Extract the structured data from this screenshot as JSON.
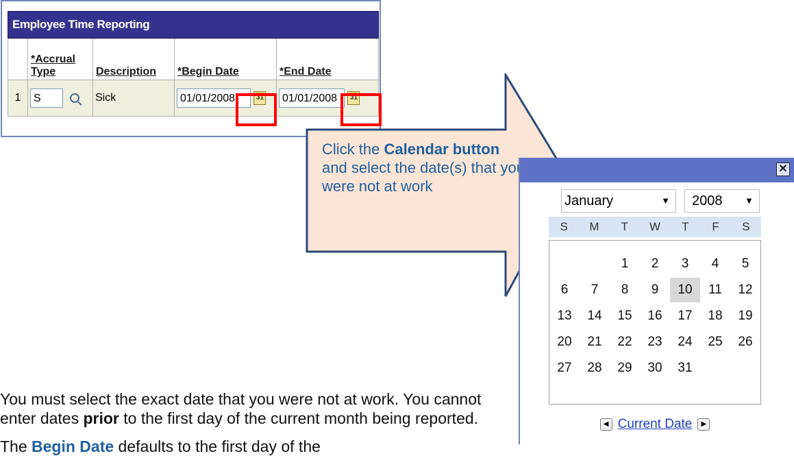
{
  "grid": {
    "title": "Employee Time Reporting",
    "columns": {
      "accrual_type": "*Accrual Type",
      "description": "Description",
      "begin_date": "*Begin Date",
      "end_date": "*End Date"
    },
    "row": {
      "num": "1",
      "accrual_type": "S",
      "description": "Sick",
      "begin_date": "01/01/2008",
      "end_date": "01/01/2008"
    },
    "calendar_icon_glyph": "31"
  },
  "callout": {
    "text_1": "Click the ",
    "bold_1": "Calendar button",
    "text_2": " and select the date(s) that you were not at work",
    "fill": "#fbe5d6",
    "stroke": "#2b4a7a"
  },
  "calendar": {
    "close_glyph": "✕",
    "month": "January",
    "year": "2008",
    "weekdays": [
      "S",
      "M",
      "T",
      "W",
      "T",
      "F",
      "S"
    ],
    "weeks": [
      [
        "",
        "",
        "1",
        "2",
        "3",
        "4",
        "5"
      ],
      [
        "6",
        "7",
        "8",
        "9",
        "10",
        "11",
        "12"
      ],
      [
        "13",
        "14",
        "15",
        "16",
        "17",
        "18",
        "19"
      ],
      [
        "20",
        "21",
        "22",
        "23",
        "24",
        "25",
        "26"
      ],
      [
        "27",
        "28",
        "29",
        "30",
        "31",
        "",
        ""
      ]
    ],
    "today": "10",
    "current_date_link": "Current Date",
    "prev_glyph": "◀",
    "next_glyph": "▶"
  },
  "body": {
    "para1_a": "You must select the exact date that you were not at work. You cannot enter dates ",
    "para1_bold": "prior",
    "para1_b": " to the first day of the current month being reported.",
    "para2_a": "The ",
    "para2_bold": "Begin Date",
    "para2_b": " defaults to the first day of the"
  }
}
